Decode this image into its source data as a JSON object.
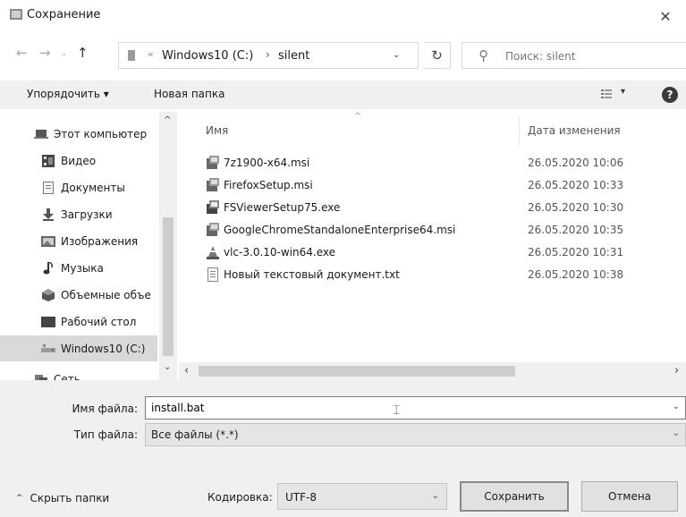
{
  "window": {
    "title": "Сохранение",
    "close_glyph": "✕"
  },
  "nav": {
    "back": "←",
    "forward": "→",
    "recent": "⌄",
    "up": "↑"
  },
  "address": {
    "separator": "«",
    "crumbs": [
      "Windows10 (C:)",
      "silent"
    ],
    "crumb_sep": "›",
    "dropdown": "⌄",
    "refresh": "↻"
  },
  "search": {
    "placeholder": "Поиск: silent",
    "icon": "⚲"
  },
  "toolbar": {
    "organize": "Упорядочить ▾",
    "new_folder": "Новая папка",
    "view_dd": "▾",
    "help": "?"
  },
  "sidebar": {
    "items": [
      {
        "label": "Этот компьютер",
        "icon": "computer-icon"
      },
      {
        "label": "Видео",
        "icon": "video-icon"
      },
      {
        "label": "Документы",
        "icon": "documents-icon"
      },
      {
        "label": "Загрузки",
        "icon": "downloads-icon"
      },
      {
        "label": "Изображения",
        "icon": "pictures-icon"
      },
      {
        "label": "Музыка",
        "icon": "music-icon"
      },
      {
        "label": "Объемные объе",
        "icon": "3d-objects-icon"
      },
      {
        "label": "Рабочий стол",
        "icon": "desktop-icon"
      },
      {
        "label": "Windows10 (C:)",
        "icon": "drive-icon"
      },
      {
        "label": "Сеть",
        "icon": "network-icon"
      }
    ],
    "scroll_up": "^",
    "scroll_down": "⌄"
  },
  "files": {
    "columns": {
      "name": "Имя",
      "date": "Дата изменения",
      "sort_glyph": "^"
    },
    "rows": [
      {
        "name": "7z1900-x64.msi",
        "date": "26.05.2020 10:06",
        "icon": "msi-icon"
      },
      {
        "name": "FirefoxSetup.msi",
        "date": "26.05.2020 10:33",
        "icon": "msi-icon"
      },
      {
        "name": "FSViewerSetup75.exe",
        "date": "26.05.2020 10:30",
        "icon": "installer-icon"
      },
      {
        "name": "GoogleChromeStandaloneEnterprise64.msi",
        "date": "26.05.2020 10:35",
        "icon": "msi-icon"
      },
      {
        "name": "vlc-3.0.10-win64.exe",
        "date": "26.05.2020 10:31",
        "icon": "vlc-icon"
      },
      {
        "name": "Новый текстовый документ.txt",
        "date": "26.05.2020 10:38",
        "icon": "text-file-icon"
      }
    ],
    "hscroll_left": "‹",
    "hscroll_right": "›"
  },
  "form": {
    "filename_label": "Имя файла:",
    "filename_value": "install.bat",
    "filetype_label": "Тип файла:",
    "filetype_value": "Все файлы  (*.*)",
    "dropdown": "⌄"
  },
  "footer": {
    "hide_folders": "Скрыть папки",
    "hide_chev": "^",
    "encoding_label": "Кодировка:",
    "encoding_value": "UTF-8",
    "save": "Сохранить",
    "cancel": "Отмена"
  },
  "colors": {
    "selected_bg": "#d9d9d9",
    "panel_bg": "#f0f0f0",
    "button_bg": "#e1e1e1"
  }
}
